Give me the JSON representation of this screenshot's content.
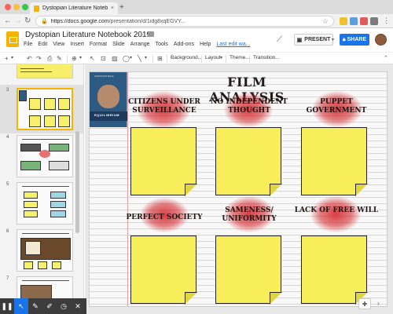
{
  "browser": {
    "tab_title": "Dystopian Literature Noteboo",
    "tab_close": "×",
    "new_tab": "+",
    "url_host": "https://docs.google.com",
    "url_path": "/presentation/d/1idg8xqEGVY...",
    "lock": "🔒",
    "star": "☆",
    "back": "←",
    "forward": "→",
    "reload": "↻",
    "menu": "⋮"
  },
  "app": {
    "title": "Dystopian Literature Notebook 2019",
    "menus": [
      "File",
      "Edit",
      "View",
      "Insert",
      "Format",
      "Slide",
      "Arrange",
      "Tools",
      "Add-ons",
      "Help"
    ],
    "last_edit": "Last edit wa...",
    "present_label": "PRESENT",
    "share_label": "SHARE",
    "accent": "#1a73e8"
  },
  "toolbar": {
    "background": "Background...",
    "layout": "Layout",
    "theme": "Theme...",
    "transition": "Transition..."
  },
  "filmstrip": {
    "slides": [
      "3",
      "4",
      "5",
      "6",
      "7"
    ]
  },
  "slide": {
    "title": "FILM ANALYSIS",
    "poster_title": "EQUILIBRIUM",
    "poster_tagline": "CHRISTIAN BALE",
    "labels": [
      "CITIZENS UNDER SURVEILLANCE",
      "NO INDEPENDENT THOUGHT",
      "PUPPET GOVERNMENT",
      "PERFECT SOCIETY",
      "SAMENESS/ UNIFORMITY",
      "LACK OF FREE WILL"
    ],
    "note_color": "#f8ee5a",
    "splash_color": "#d21e23"
  }
}
